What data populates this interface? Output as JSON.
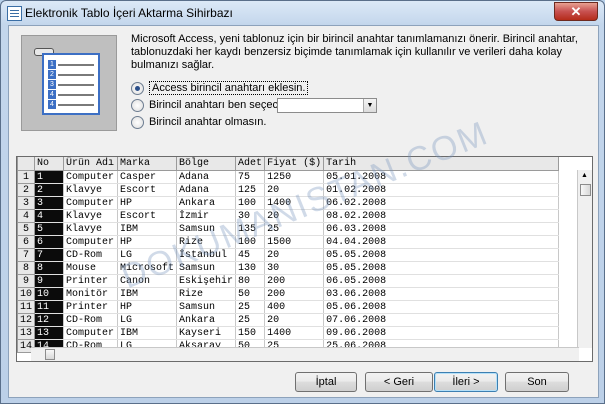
{
  "window": {
    "title": "Elektronik Tablo İçeri Aktarma Sihirbazı",
    "close_glyph": "✕"
  },
  "description": "Microsoft Access, yeni tablonuz için bir birincil anahtar tanımlamanızı önerir. Birincil anahtar, tablonuzdaki her kaydı benzersiz biçimde tanımlamak için kullanılır ve verileri daha kolay bulmanızı sağlar.",
  "options": [
    {
      "label": "Access birincil anahtarı eklesin.",
      "checked": true
    },
    {
      "label": "Birincil anahtarı ben seçeceğim.",
      "checked": false
    },
    {
      "label": "Birincil anahtar olmasın.",
      "checked": false
    }
  ],
  "combo_value": "",
  "grid": {
    "columns": [
      "No",
      "Ürün Adı",
      "Marka",
      "Bölge",
      "Adet",
      "Fiyat ($)",
      "Tarih"
    ],
    "rows": [
      [
        "1",
        "1",
        "Computer",
        "Casper",
        "Adana",
        "75",
        "1250",
        "05.01.2008"
      ],
      [
        "2",
        "2",
        "Klavye",
        "Escort",
        "Adana",
        "125",
        "20",
        "01.02.2008"
      ],
      [
        "3",
        "3",
        "Computer",
        "HP",
        "Ankara",
        "100",
        "1400",
        "06.02.2008"
      ],
      [
        "4",
        "4",
        "Klavye",
        "Escort",
        "İzmir",
        "30",
        "20",
        "08.02.2008"
      ],
      [
        "5",
        "5",
        "Klavye",
        "IBM",
        "Samsun",
        "135",
        "25",
        "06.03.2008"
      ],
      [
        "6",
        "6",
        "Computer",
        "HP",
        "Rize",
        "100",
        "1500",
        "04.04.2008"
      ],
      [
        "7",
        "7",
        "CD-Rom",
        "LG",
        "İstanbul",
        "45",
        "20",
        "05.05.2008"
      ],
      [
        "8",
        "8",
        "Mouse",
        "Microsoft",
        "Samsun",
        "130",
        "30",
        "05.05.2008"
      ],
      [
        "9",
        "9",
        "Printer",
        "Canon",
        "Eskişehir",
        "80",
        "200",
        "06.05.2008"
      ],
      [
        "10",
        "10",
        "Monitör",
        "IBM",
        "Rize",
        "50",
        "200",
        "03.06.2008"
      ],
      [
        "11",
        "11",
        "Printer",
        "HP",
        "Samsun",
        "25",
        "400",
        "05.06.2008"
      ],
      [
        "12",
        "12",
        "CD-Rom",
        "LG",
        "Ankara",
        "25",
        "20",
        "07.06.2008"
      ],
      [
        "13",
        "13",
        "Computer",
        "IBM",
        "Kayseri",
        "150",
        "1400",
        "09.06.2008"
      ],
      [
        "14",
        "14",
        "CD-Rom",
        "LG",
        "Aksaray",
        "50",
        "25",
        "25.06.2008"
      ]
    ]
  },
  "watermark": "DOKUMANISTAN.COM",
  "buttons": {
    "cancel": "İptal",
    "back": "< Geri",
    "next": "İleri >",
    "finish": "Son"
  }
}
